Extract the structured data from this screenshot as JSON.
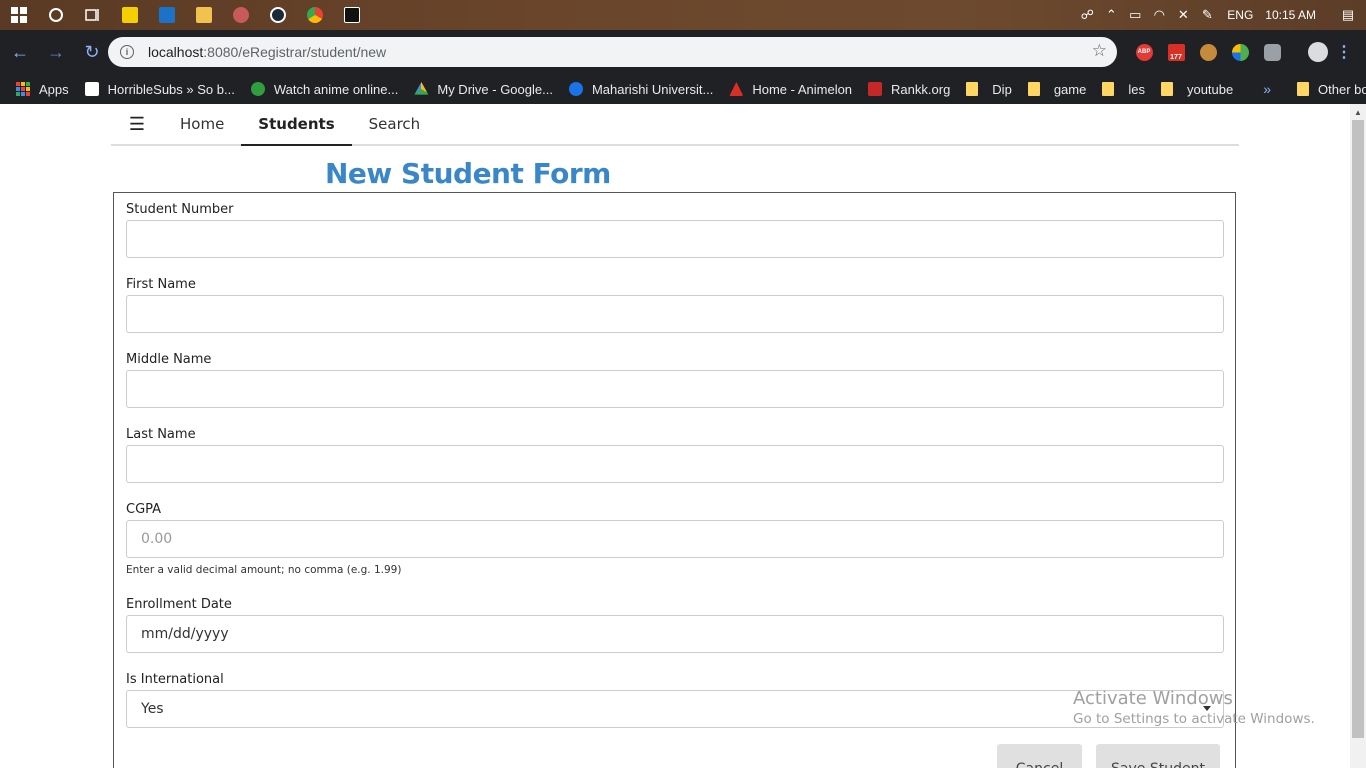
{
  "taskbar": {
    "language": "ENG",
    "time": "10:15 AM",
    "apps": [
      {
        "name": "sticky-notes-icon",
        "color": "#f4d000"
      },
      {
        "name": "outlook-icon",
        "color": "#1a73c8"
      },
      {
        "name": "file-explorer-icon",
        "color": "#f2c14e"
      },
      {
        "name": "game-app-icon",
        "color": "#c85a5a"
      },
      {
        "name": "steam-icon",
        "color": "#1b2838"
      },
      {
        "name": "chrome-icon",
        "color": "#34a853"
      },
      {
        "name": "intellij-icon",
        "color": "#111111"
      }
    ]
  },
  "browser": {
    "url_host": "localhost",
    "url_rest": ":8080/eRegistrar/student/new",
    "extensions": [
      {
        "name": "adblock-icon",
        "color": "#e53935",
        "label": "ABP"
      },
      {
        "name": "calendar-extension-icon",
        "color": "#d93025",
        "label": "177"
      },
      {
        "name": "cookie-icon",
        "color": "#c58a3b",
        "label": ""
      },
      {
        "name": "google-extension-icon",
        "color": "#4caf50",
        "label": ""
      },
      {
        "name": "extension-icon",
        "color": "#9aa0a6",
        "label": ""
      },
      {
        "name": "profile-avatar-icon",
        "color": "#dadce0",
        "label": ""
      }
    ]
  },
  "bookmarks": {
    "items": [
      {
        "label": "Apps",
        "color": "#ea4335"
      },
      {
        "label": "HorribleSubs » So b...",
        "color": "#ffffff"
      },
      {
        "label": "Watch anime online...",
        "color": "#2e9e3e"
      },
      {
        "label": "My Drive - Google...",
        "color": "#fbbc04"
      },
      {
        "label": "Maharishi Universit...",
        "color": "#1a73e8"
      },
      {
        "label": "Home - Animelon",
        "color": "#d93025"
      },
      {
        "label": "Rankk.org",
        "color": "#c62828"
      }
    ],
    "folders": [
      "Dip",
      "game",
      "les",
      "youtube"
    ],
    "more": "»",
    "other": "Other bookmarks"
  },
  "nav": {
    "menu_icon": "☰",
    "links": [
      "Home",
      "Students",
      "Search"
    ],
    "active": "Students"
  },
  "form": {
    "title": "New Student Form",
    "student_number_label": "Student Number",
    "student_number_value": "",
    "first_name_label": "First Name",
    "first_name_value": "",
    "middle_name_label": "Middle Name",
    "middle_name_value": "",
    "last_name_label": "Last Name",
    "last_name_value": "",
    "cgpa_label": "CGPA",
    "cgpa_placeholder": "0.00",
    "cgpa_help": "Enter a valid decimal amount; no comma (e.g. 1.99)",
    "enrollment_date_label": "Enrollment Date",
    "enrollment_date_placeholder": "mm/dd/yyyy",
    "is_international_label": "Is International",
    "is_international_value": "Yes",
    "cancel_label": "Cancel",
    "save_label": "Save Student"
  },
  "watermark": {
    "line1": "Activate Windows",
    "line2": "Go to Settings to activate Windows."
  }
}
